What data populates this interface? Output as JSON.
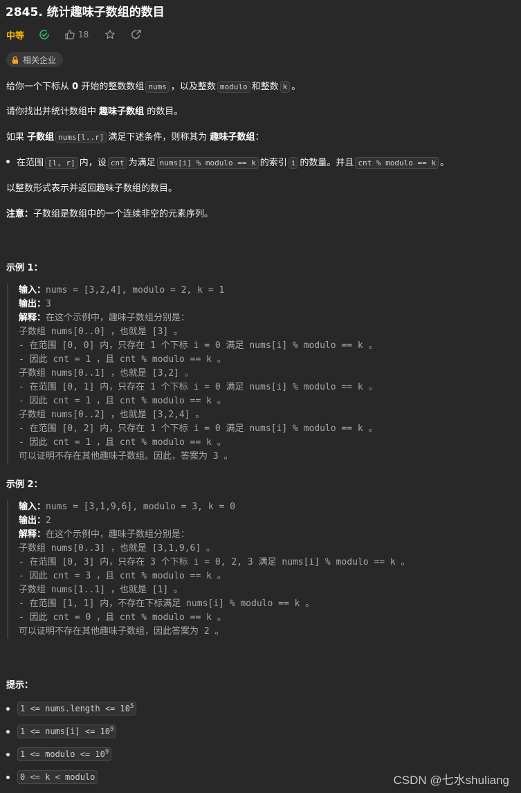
{
  "problem": {
    "title": "2845. 统计趣味子数组的数目",
    "difficulty": "中等",
    "difficulty_color": "#ffb800",
    "like_count": "18",
    "company_tag": "相关企业",
    "icons": {
      "solved": "check-circle-icon",
      "like": "thumbs-up-icon",
      "favorite": "star-icon",
      "share": "share-icon",
      "company_lock": "lock-icon"
    }
  },
  "description": {
    "p1": {
      "t1": "给你一个下标从 ",
      "b1": "0",
      "t2": " 开始的整数数组",
      "c1": "nums",
      "t3": "，以及整数",
      "c2": "modulo",
      "t4": "和整数",
      "c3": "k",
      "t5": "。"
    },
    "p2": {
      "t1": "请你找出并统计数组中 ",
      "b1": "趣味子数组",
      "t2": " 的数目。"
    },
    "p3": {
      "t1": "如果 ",
      "b1": "子数组",
      "c1": "nums[l..r]",
      "t2": "满足下述条件，则称其为 ",
      "b2": "趣味子数组",
      "t3": "："
    },
    "bullet": {
      "t1": "在范围",
      "c1": "[l, r]",
      "t2": "内，设",
      "c2": "cnt",
      "t3": "为满足",
      "c3": "nums[i] % modulo == k",
      "t4": "的索引",
      "c4": "i",
      "t5": "的数量。并且",
      "c5": "cnt % modulo == k",
      "t6": "。"
    },
    "p4": "以整数形式表示并返回趣味子数组的数目。",
    "note": {
      "label": "注意：",
      "text": "子数组是数组中的一个连续非空的元素序列。"
    }
  },
  "examples": [
    {
      "title": "示例 1：",
      "input_label": "输入：",
      "input": "nums = [3,2,4], modulo = 2, k = 1",
      "output_label": "输出：",
      "output": "3",
      "explain_label": "解释：",
      "explain": "在这个示例中，趣味子数组分别是：",
      "lines": [
        "子数组 nums[0..0] ，也就是 [3] 。",
        "- 在范围 [0, 0] 内，只存在 1 个下标 i = 0 满足 nums[i] % modulo == k 。",
        "- 因此 cnt = 1 ，且 cnt % modulo == k 。",
        "子数组 nums[0..1] ，也就是 [3,2] 。",
        "- 在范围 [0, 1] 内，只存在 1 个下标 i = 0 满足 nums[i] % modulo == k 。",
        "- 因此 cnt = 1 ，且 cnt % modulo == k 。",
        "子数组 nums[0..2] ，也就是 [3,2,4] 。",
        "- 在范围 [0, 2] 内，只存在 1 个下标 i = 0 满足 nums[i] % modulo == k 。",
        "- 因此 cnt = 1 ，且 cnt % modulo == k 。",
        "可以证明不存在其他趣味子数组。因此，答案为 3 。"
      ]
    },
    {
      "title": "示例 2：",
      "input_label": "输入：",
      "input": "nums = [3,1,9,6], modulo = 3, k = 0",
      "output_label": "输出：",
      "output": "2",
      "explain_label": "解释：",
      "explain": "在这个示例中，趣味子数组分别是：",
      "lines": [
        "子数组 nums[0..3] ，也就是 [3,1,9,6] 。",
        "- 在范围 [0, 3] 内，只存在 3 个下标 i = 0, 2, 3 满足 nums[i] % modulo == k 。",
        "- 因此 cnt = 3 ，且 cnt % modulo == k 。",
        "子数组 nums[1..1] ，也就是 [1] 。",
        "- 在范围 [1, 1] 内，不存在下标满足 nums[i] % modulo == k 。",
        "- 因此 cnt = 0 ，且 cnt % modulo == k 。",
        "可以证明不存在其他趣味子数组，因此答案为 2 。"
      ]
    }
  ],
  "hints": {
    "title": "提示：",
    "items": [
      {
        "text": "1 <= nums.length <= 10",
        "sup": "5"
      },
      {
        "text": "1 <= nums[i] <= 10",
        "sup": "9"
      },
      {
        "text": "1 <= modulo <= 10",
        "sup": "9"
      },
      {
        "text": "0 <= k < modulo",
        "sup": ""
      }
    ]
  },
  "watermark": "CSDN @七水shuliang"
}
